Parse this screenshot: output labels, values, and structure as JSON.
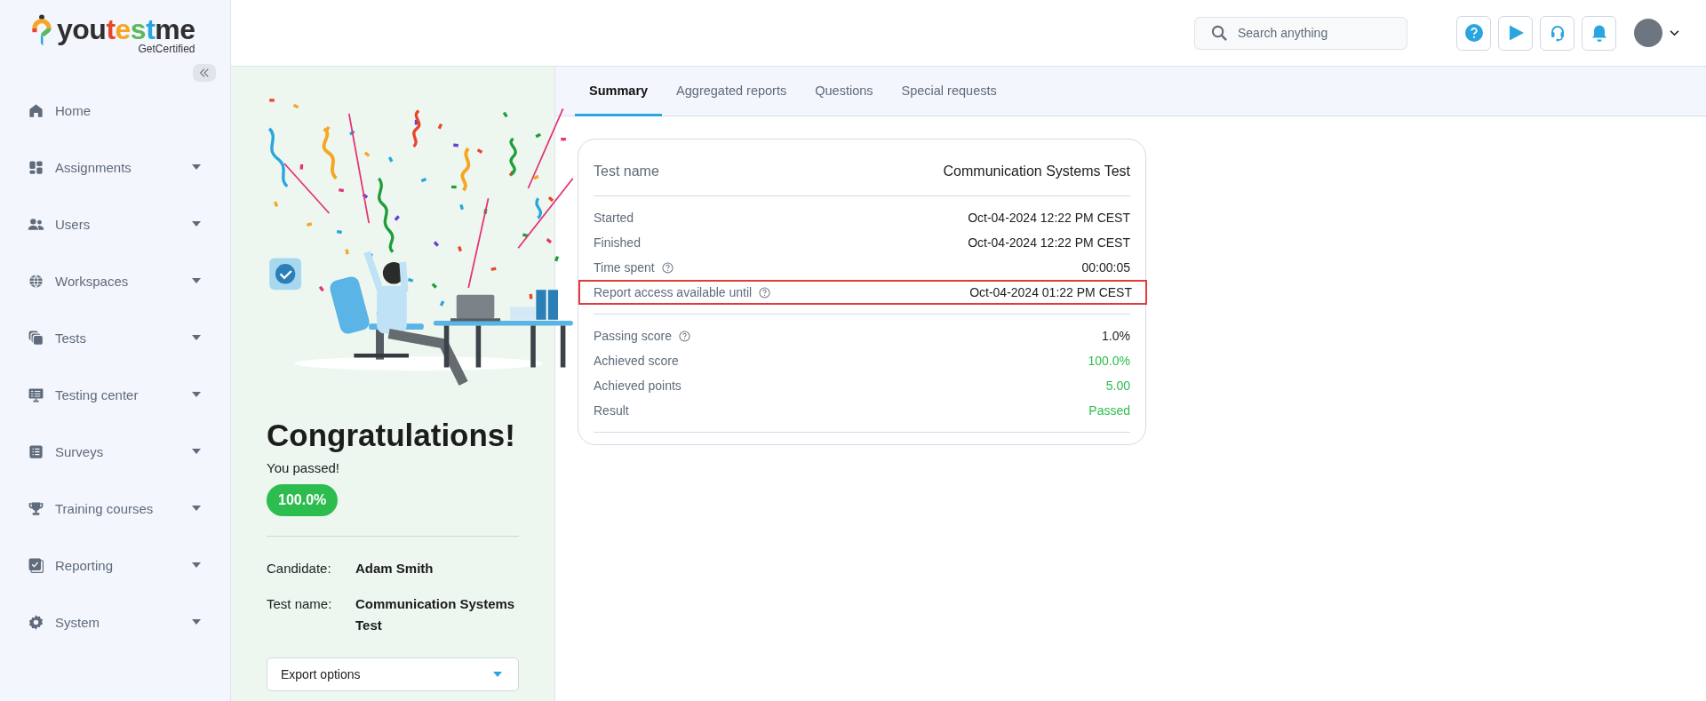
{
  "logo": {
    "parts": [
      {
        "text": "you",
        "color": "#2f2f2f"
      },
      {
        "text": "t",
        "color": "#e8472b"
      },
      {
        "text": "e",
        "color": "#f5a623"
      },
      {
        "text": "s",
        "color": "#5cb85c"
      },
      {
        "text": "t",
        "color": "#2aa5e0"
      },
      {
        "text": "me",
        "color": "#2f2f2f"
      }
    ],
    "tagline": "GetCertified"
  },
  "sidebar": {
    "items": [
      {
        "label": "Home",
        "has_submenu": false
      },
      {
        "label": "Assignments",
        "has_submenu": true
      },
      {
        "label": "Users",
        "has_submenu": true
      },
      {
        "label": "Workspaces",
        "has_submenu": true
      },
      {
        "label": "Tests",
        "has_submenu": true
      },
      {
        "label": "Testing center",
        "has_submenu": true
      },
      {
        "label": "Surveys",
        "has_submenu": true
      },
      {
        "label": "Training courses",
        "has_submenu": true
      },
      {
        "label": "Reporting",
        "has_submenu": true
      },
      {
        "label": "System",
        "has_submenu": true
      }
    ]
  },
  "search": {
    "placeholder": "Search anything"
  },
  "tabs": [
    {
      "label": "Summary",
      "selected": true
    },
    {
      "label": "Aggregated reports",
      "selected": false
    },
    {
      "label": "Questions",
      "selected": false
    },
    {
      "label": "Special requests",
      "selected": false
    }
  ],
  "result": {
    "title": "Congratulations!",
    "message": "You passed!",
    "score_badge": "100.0%",
    "details": [
      {
        "label": "Candidate:",
        "value": "Adam Smith"
      },
      {
        "label": "Test name:",
        "value": "Communication Systems Test"
      }
    ],
    "export_dropdown": {
      "label": "Export options"
    }
  },
  "summary": {
    "header": {
      "label": "Test name",
      "value": "Communication Systems Test"
    },
    "sections": [
      {
        "rows": [
          {
            "label": "Started",
            "value": "Oct-04-2024 12:22 PM CEST",
            "help": false,
            "color": "#1c1c1c",
            "highlighted": false
          },
          {
            "label": "Finished",
            "value": "Oct-04-2024 12:22 PM CEST",
            "help": false,
            "color": "#1c1c1c",
            "highlighted": false
          },
          {
            "label": "Time spent",
            "value": "00:00:05",
            "help": true,
            "color": "#1c1c1c",
            "highlighted": false
          },
          {
            "label": "Report access available until",
            "value": "Oct-04-2024 01:22 PM CEST",
            "help": true,
            "color": "#1c1c1c",
            "highlighted": true
          }
        ]
      },
      {
        "rows": [
          {
            "label": "Passing score",
            "value": "1.0%",
            "help": true,
            "color": "#1c1c1c",
            "highlighted": false
          },
          {
            "label": "Achieved score",
            "value": "100.0%",
            "help": false,
            "color": "#2dbd4e",
            "highlighted": false
          },
          {
            "label": "Achieved points",
            "value": "5.00",
            "help": false,
            "color": "#2dbd4e",
            "highlighted": false
          },
          {
            "label": "Result",
            "value": "Passed",
            "help": false,
            "color": "#2dbd4e",
            "highlighted": false
          }
        ]
      }
    ]
  }
}
